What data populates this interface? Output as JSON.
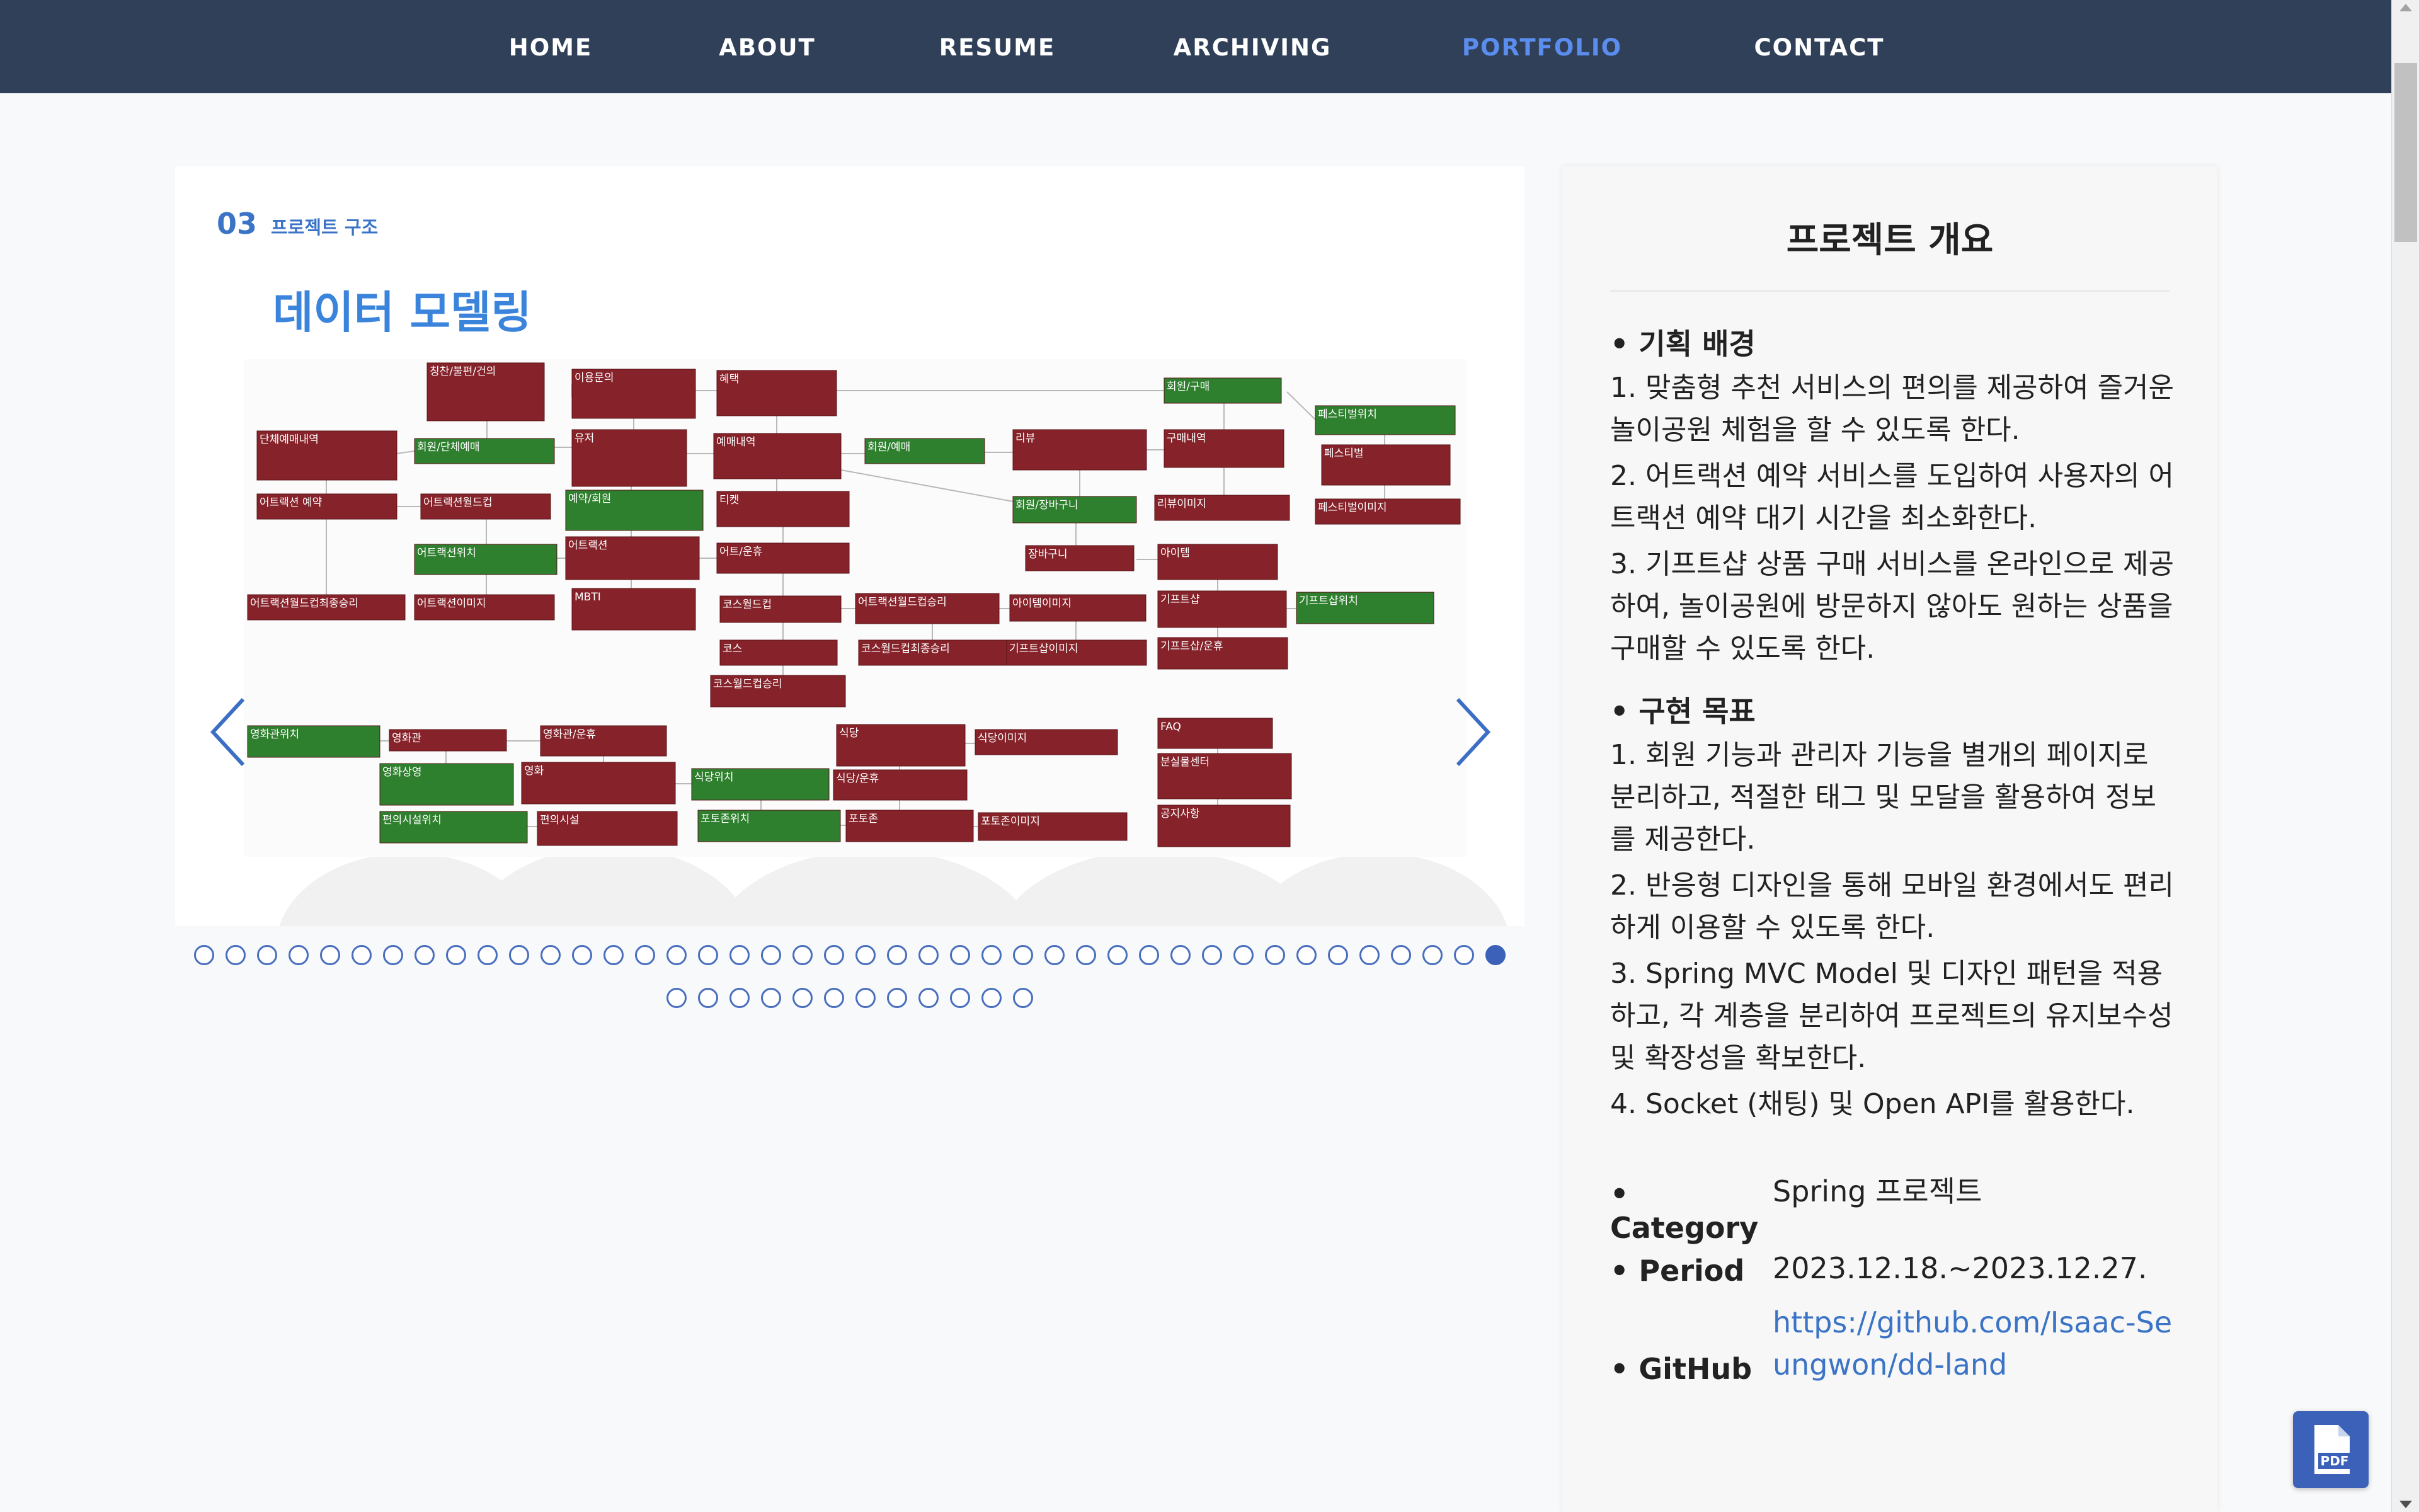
{
  "nav": {
    "items": [
      "HOME",
      "ABOUT",
      "RESUME",
      "ARCHIVING",
      "PORTFOLIO",
      "CONTACT"
    ],
    "active": "PORTFOLIO"
  },
  "slide": {
    "number": "03",
    "section": "프로젝트 구조",
    "title": "데이터 모델링",
    "erd_tables": [
      {
        "label": "칭찬/불편/건의",
        "color": "red"
      },
      {
        "label": "이용문의",
        "color": "red"
      },
      {
        "label": "혜택",
        "color": "red"
      },
      {
        "label": "회원/구매",
        "color": "green"
      },
      {
        "label": "페스티벌위치",
        "color": "green"
      },
      {
        "label": "단체예매내역",
        "color": "red"
      },
      {
        "label": "회원/단체예매",
        "color": "green"
      },
      {
        "label": "유저",
        "color": "red"
      },
      {
        "label": "예매내역",
        "color": "red"
      },
      {
        "label": "회원/예매",
        "color": "green"
      },
      {
        "label": "리뷰",
        "color": "red"
      },
      {
        "label": "구매내역",
        "color": "red"
      },
      {
        "label": "페스티벌",
        "color": "red"
      },
      {
        "label": "어트랙션 예약",
        "color": "red"
      },
      {
        "label": "어트랙션월드컵",
        "color": "red"
      },
      {
        "label": "예약/회원",
        "color": "green"
      },
      {
        "label": "티켓",
        "color": "red"
      },
      {
        "label": "회원/장바구니",
        "color": "green"
      },
      {
        "label": "리뷰이미지",
        "color": "red"
      },
      {
        "label": "페스티벌이미지",
        "color": "red"
      },
      {
        "label": "어트랙션위치",
        "color": "green"
      },
      {
        "label": "어트랙션",
        "color": "red"
      },
      {
        "label": "어트/운휴",
        "color": "red"
      },
      {
        "label": "장바구니",
        "color": "red"
      },
      {
        "label": "아이템",
        "color": "red"
      },
      {
        "label": "어트랙션월드컵최종승리",
        "color": "red"
      },
      {
        "label": "어트랙션이미지",
        "color": "red"
      },
      {
        "label": "MBTI",
        "color": "red"
      },
      {
        "label": "코스월드컵",
        "color": "red"
      },
      {
        "label": "어트랙션월드컵승리",
        "color": "red"
      },
      {
        "label": "아이템이미지",
        "color": "red"
      },
      {
        "label": "기프트샵",
        "color": "red"
      },
      {
        "label": "기프트샵위치",
        "color": "green"
      },
      {
        "label": "코스",
        "color": "red"
      },
      {
        "label": "코스월드컵최종승리",
        "color": "red"
      },
      {
        "label": "기프트샵이미지",
        "color": "red"
      },
      {
        "label": "기프트샵/운휴",
        "color": "red"
      },
      {
        "label": "코스월드컵승리",
        "color": "red"
      },
      {
        "label": "영화관위치",
        "color": "green"
      },
      {
        "label": "영화관",
        "color": "red"
      },
      {
        "label": "영화관/운휴",
        "color": "red"
      },
      {
        "label": "식당",
        "color": "red"
      },
      {
        "label": "식당이미지",
        "color": "red"
      },
      {
        "label": "FAQ",
        "color": "red"
      },
      {
        "label": "영화상영",
        "color": "green"
      },
      {
        "label": "영화",
        "color": "red"
      },
      {
        "label": "식당위치",
        "color": "green"
      },
      {
        "label": "식당/운휴",
        "color": "red"
      },
      {
        "label": "분실물센터",
        "color": "red"
      },
      {
        "label": "편의시설위치",
        "color": "green"
      },
      {
        "label": "편의시설",
        "color": "red"
      },
      {
        "label": "포토존위치",
        "color": "green"
      },
      {
        "label": "포토존",
        "color": "red"
      },
      {
        "label": "포토존이미지",
        "color": "red"
      },
      {
        "label": "공지사항",
        "color": "red"
      }
    ]
  },
  "pagination": {
    "row1_count": 42,
    "row2_count": 12,
    "active_index": 41
  },
  "overview": {
    "title": "프로젝트 개요",
    "background_title": "• 기획 배경",
    "background_items": [
      "1. 맞춤형 추천 서비스의 편의를 제공하여 즐거운 놀이공원 체험을 할 수 있도록 한다.",
      "2. 어트랙션 예약 서비스를 도입하여 사용자의 어트랙션 예약 대기 시간을 최소화한다.",
      "3. 기프트샵 상품 구매 서비스를 온라인으로 제공하여, 놀이공원에 방문하지 않아도 원하는 상품을 구매할 수 있도록 한다."
    ],
    "goal_title": "• 구현 목표",
    "goal_items": [
      "1. 회원 기능과 관리자 기능을 별개의 페이지로 분리하고, 적절한 태그 및 모달을 활용하여 정보를 제공한다.",
      "2. 반응형 디자인을 통해 모바일 환경에서도 편리하게 이용할 수 있도록 한다.",
      "3. Spring MVC Model 및 디자인 패턴을 적용하고, 각 계층을 분리하여 프로젝트의 유지보수성 및 확장성을 확보한다.",
      "4. Socket (채팅) 및 Open API를 활용한다."
    ],
    "category_label": "• Category",
    "category_value": "Spring 프로젝트",
    "period_label": "• Period",
    "period_value": "2023.12.18.~2023.12.27.",
    "github_label": "• GitHub",
    "github_value": "https://github.com/Isaac-Seungwon/dd-land"
  },
  "pdf_button": {
    "icon": "pdf-file-icon",
    "label": "PDF"
  },
  "colors": {
    "nav_bg": "#2f4058",
    "nav_active": "#5b8def",
    "accent": "#3b74c6",
    "erd_red": "#85222a",
    "erd_green": "#2e7f2e"
  }
}
